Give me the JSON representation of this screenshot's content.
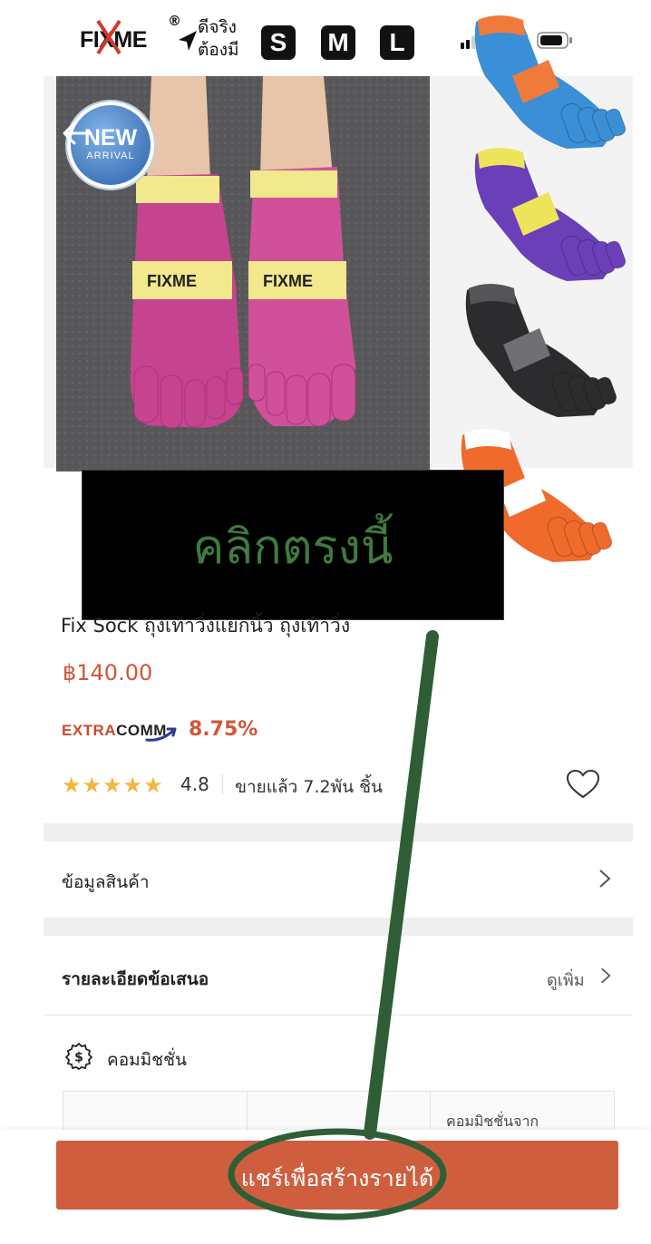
{
  "status_bar": {
    "brand": "FIXME",
    "registered": "®",
    "tagline_line1": "ดีจริง",
    "tagline_line2": "ต้องมี",
    "sizes": [
      "S",
      "M",
      "L"
    ]
  },
  "gallery": {
    "badge_new": "NEW",
    "badge_arrival": "ARRIVAL",
    "colors": [
      "#3a8fd6",
      "#6a3fb8",
      "#2c2c2e",
      "#f06a2c"
    ]
  },
  "overlay": {
    "label": "คลิกตรงนี้"
  },
  "product": {
    "title": "Fix Sock ถุงเท้าวิ่งแยกนิ้ว ถุงเท้าวิ่ง",
    "price": "฿140.00",
    "extracomm_brand_a": "EXTRA",
    "extracomm_brand_b": "COMM",
    "extracomm_rate": "8.75%",
    "stars": "★★★★★",
    "rating": "4.8",
    "sold": "ขายแล้ว 7.2พัน ชิ้น"
  },
  "sections": {
    "product_info": "ข้อมูลสินค้า",
    "offer_details": "รายละเอียดข้อเสนอ",
    "see_more": "ดูเพิ่ม",
    "commission": "คอมมิชชั่น",
    "table_header": "คอมมิชชั่นจาก"
  },
  "share_button": {
    "label": "แชร์เพื่อสร้างรายได้"
  },
  "colors": {
    "accent": "#cf5e3f",
    "price": "#d0573a",
    "annotation": "#2f5e36",
    "star": "#f4b63f"
  }
}
